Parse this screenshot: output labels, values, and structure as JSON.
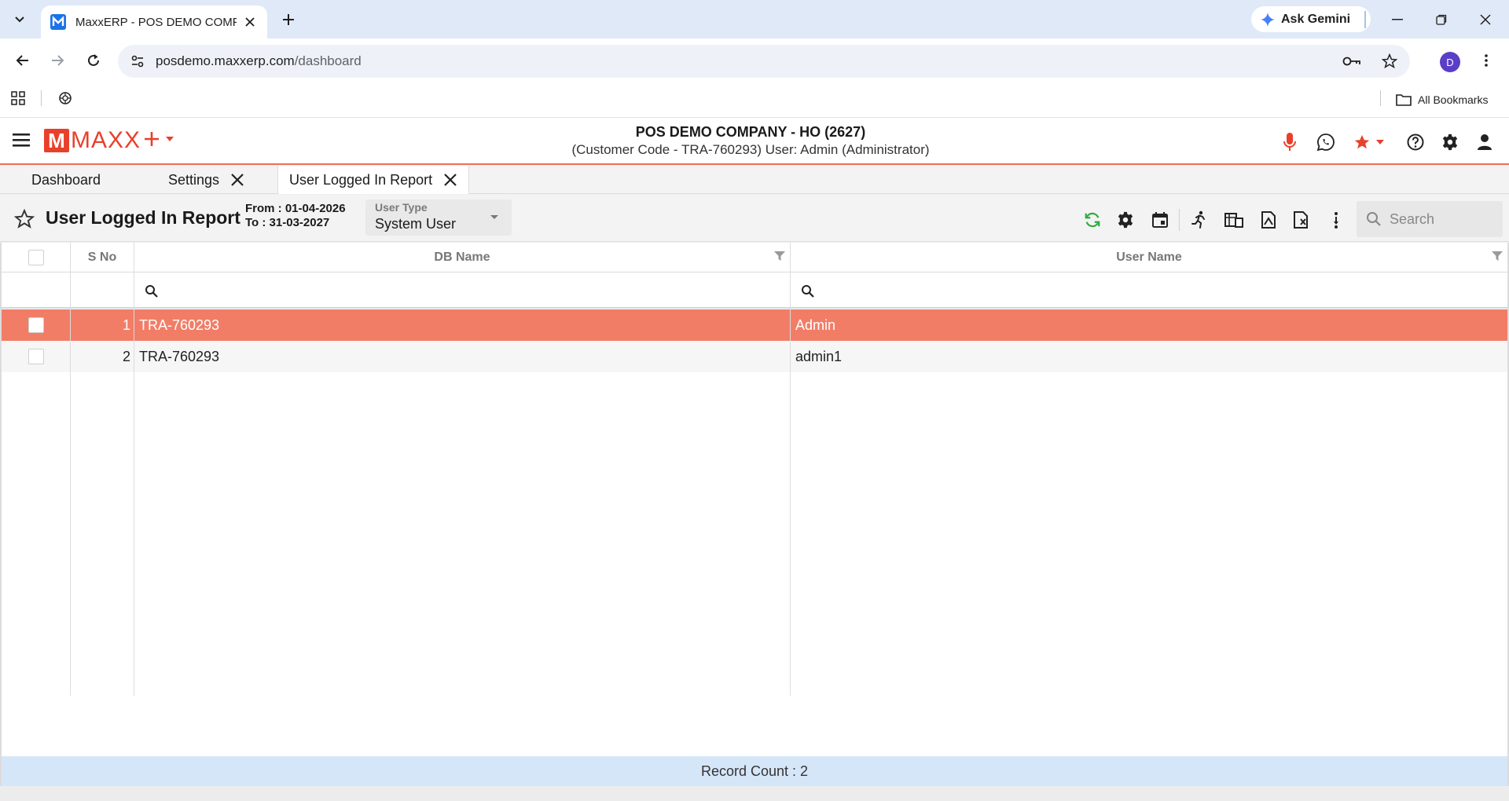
{
  "browser": {
    "tab_title": "MaxxERP - POS DEMO COMPANY",
    "url_host": "posdemo.maxxerp.com",
    "url_path": "/dashboard",
    "ask_gemini": "Ask Gemini",
    "profile_initial": "D",
    "all_bookmarks": "All Bookmarks"
  },
  "header": {
    "logo_text": "MAXX",
    "company_line1": "POS DEMO COMPANY - HO (2627)",
    "company_line2": "(Customer Code - TRA-760293) User: Admin (Administrator)"
  },
  "app_tabs": [
    {
      "label": "Dashboard"
    },
    {
      "label": "Settings"
    },
    {
      "label": "User Logged In Report"
    }
  ],
  "report": {
    "title": "User Logged In Report",
    "from": "From : 01-04-2026",
    "to": "To : 31-03-2027",
    "user_type_label": "User Type",
    "user_type_value": "System User",
    "search_placeholder": "Search"
  },
  "table": {
    "columns": [
      "S No",
      "DB Name",
      "User Name"
    ],
    "rows": [
      {
        "sno": "1",
        "db": "TRA-760293",
        "user": "Admin",
        "selected": true
      },
      {
        "sno": "2",
        "db": "TRA-760293",
        "user": "admin1",
        "selected": false
      }
    ]
  },
  "footer": {
    "record_count": "Record Count : 2"
  },
  "colors": {
    "brand": "#e8402b",
    "selected_row": "#f27d67",
    "refresh_icon": "#2eaa3c",
    "footer_bg": "#d6e6f9"
  }
}
